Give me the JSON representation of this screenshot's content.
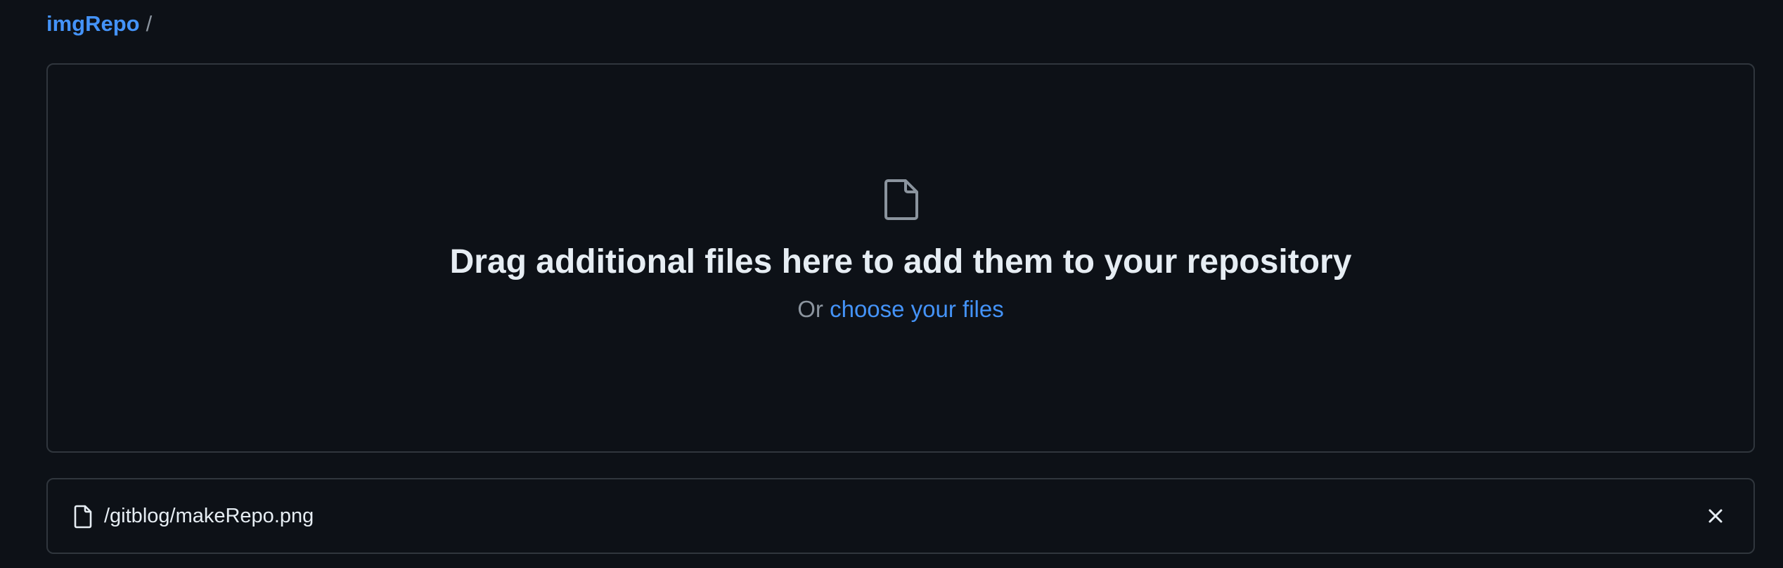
{
  "breadcrumb": {
    "repo": "imgRepo",
    "separator": "/"
  },
  "dropzone": {
    "icon": "file-icon",
    "title": "Drag additional files here to add them to your repository",
    "prefix": "Or",
    "choose_link": "choose your files"
  },
  "files": [
    {
      "icon": "file-icon",
      "name": "/gitblog/makeRepo.png",
      "remove_icon": "close-icon"
    }
  ],
  "colors": {
    "background": "#0d1117",
    "border": "#30363d",
    "link": "#4493f8",
    "text": "#e6edf3",
    "muted": "#8b949e"
  }
}
